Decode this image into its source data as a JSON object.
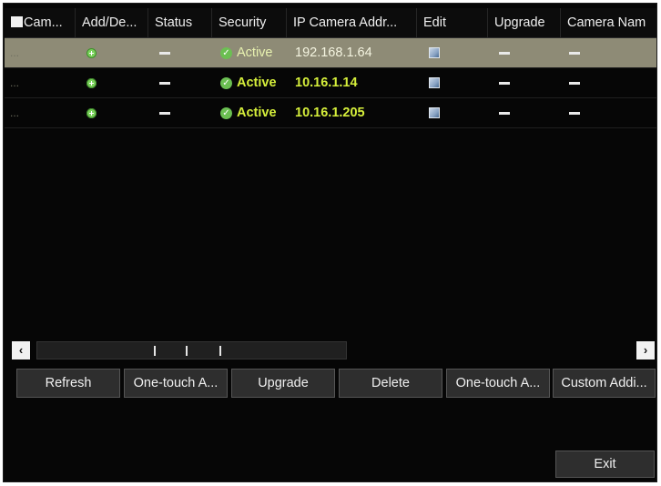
{
  "table": {
    "headers": [
      "Cam...",
      "Add/De...",
      "Status",
      "Security",
      "IP Camera Addr...",
      "Edit",
      "Upgrade",
      "Camera Nam"
    ],
    "rows": [
      {
        "dots": "...",
        "security": "Active",
        "ip": "192.168.1.64"
      },
      {
        "dots": "...",
        "security": "Active",
        "ip": "10.16.1.14"
      },
      {
        "dots": "...",
        "security": "Active",
        "ip": "10.16.1.205"
      }
    ]
  },
  "scrollbar": {
    "left_arrow": "‹",
    "right_arrow": "›"
  },
  "buttons": {
    "refresh": "Refresh",
    "one_touch_activate": "One-touch A...",
    "upgrade": "Upgrade",
    "delete": "Delete",
    "one_touch_adding": "One-touch A...",
    "custom_adding": "Custom Addi...",
    "exit": "Exit"
  },
  "icons": {
    "add": "add-icon",
    "status": "dash-icon",
    "security": "check-icon",
    "edit": "edit-icon"
  },
  "colors": {
    "background": "#060606",
    "selected_row": "#8e8b76",
    "ip_text": "#d6ef3b",
    "add_green": "#79d05a"
  }
}
